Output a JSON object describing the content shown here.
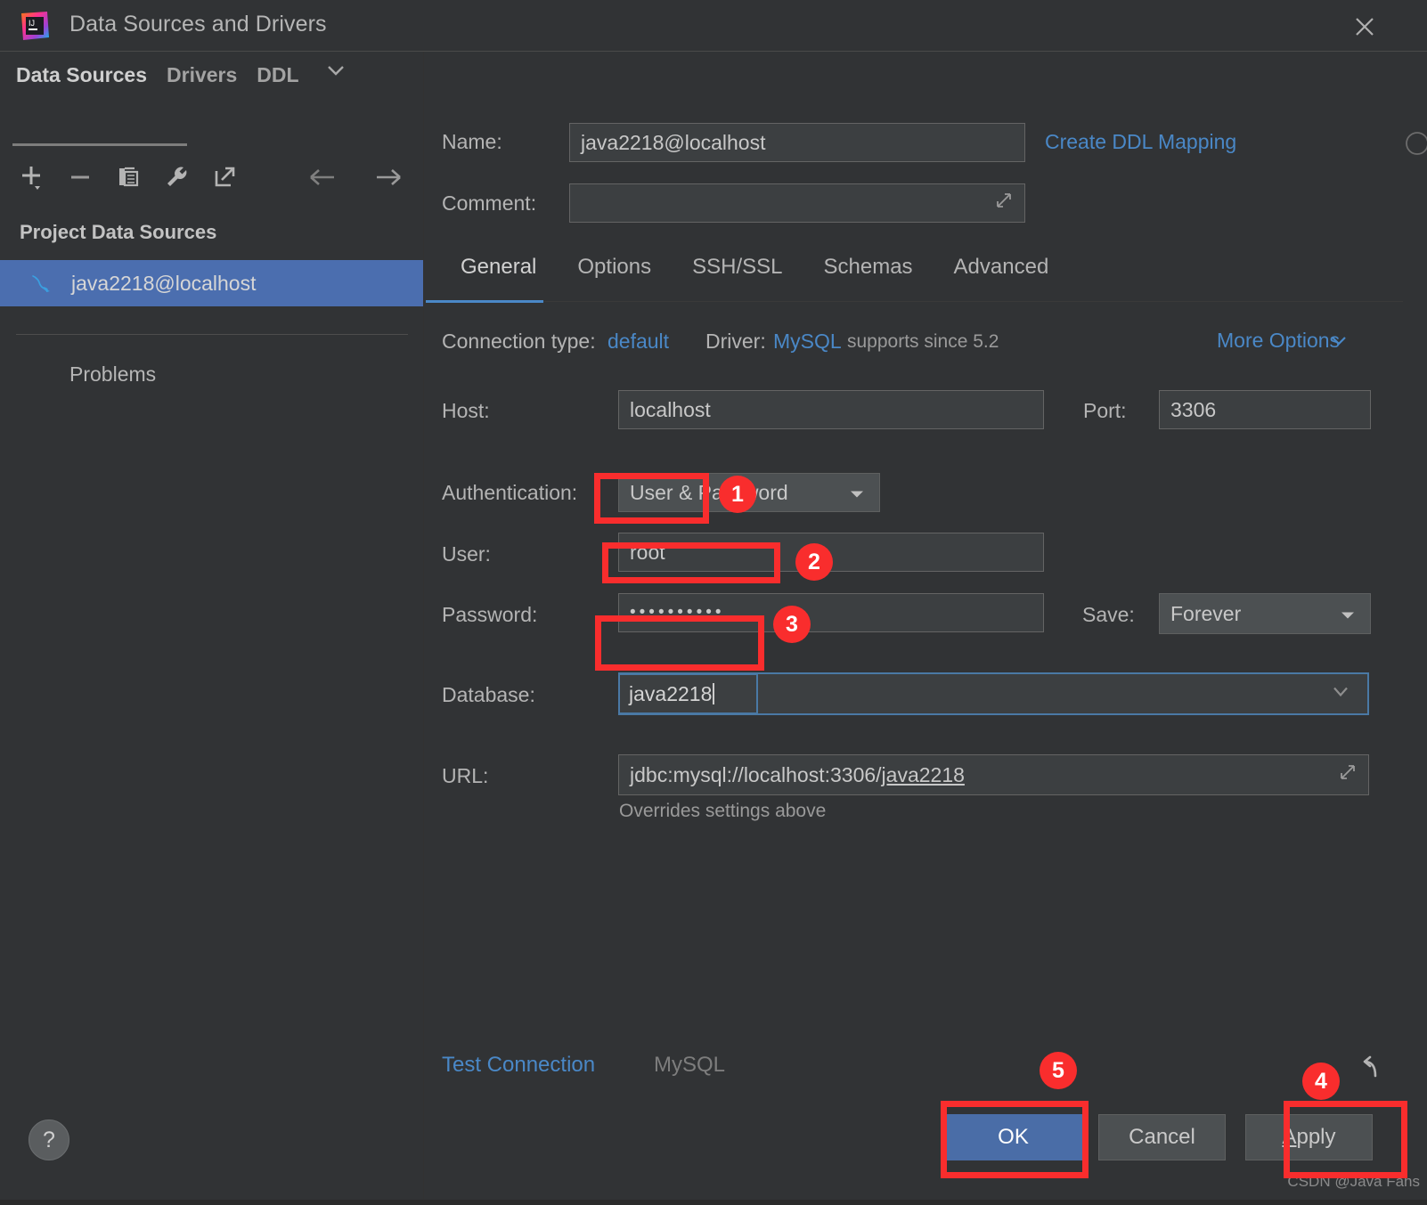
{
  "window": {
    "title": "Data Sources and Drivers",
    "app_icon": "intellij-idea-icon",
    "close_icon": "close-icon"
  },
  "sidebar": {
    "tabs": [
      {
        "label": "Data Sources",
        "active": true
      },
      {
        "label": "Drivers",
        "active": false
      },
      {
        "label": "DDL",
        "active": false
      }
    ],
    "ddl_chevron_icon": "chevron-down-icon",
    "toolbar": [
      {
        "name": "add-button",
        "icon": "plus-icon"
      },
      {
        "name": "remove-button",
        "icon": "minus-icon"
      },
      {
        "name": "copy-button",
        "icon": "copy-icon"
      },
      {
        "name": "properties-button",
        "icon": "wrench-icon"
      },
      {
        "name": "export-button",
        "icon": "external-link-icon"
      }
    ],
    "nav": [
      {
        "name": "back-button",
        "icon": "arrow-left-icon"
      },
      {
        "name": "forward-button",
        "icon": "arrow-right-icon"
      }
    ],
    "section_title": "Project Data Sources",
    "data_source": {
      "label": "java2218@localhost",
      "icon": "mysql-dolphin-icon",
      "selected": true
    },
    "problems_label": "Problems"
  },
  "header": {
    "name_label": "Name:",
    "name_value": "java2218@localhost",
    "name_status_icon": "circle-icon",
    "create_ddl_mapping": "Create DDL Mapping",
    "comment_label": "Comment:",
    "comment_value": "",
    "comment_placeholder": "",
    "comment_expand_icon": "expand-icon"
  },
  "tabs": [
    {
      "label": "General",
      "active": true
    },
    {
      "label": "Options",
      "active": false
    },
    {
      "label": "SSH/SSL",
      "active": false
    },
    {
      "label": "Schemas",
      "active": false
    },
    {
      "label": "Advanced",
      "active": false
    }
  ],
  "general": {
    "connection_type_label": "Connection type:",
    "connection_type_value": "default",
    "driver_label": "Driver:",
    "driver_value": "MySQL",
    "driver_note": "supports since 5.2",
    "more_options_label": "More Options",
    "more_options_icon": "chevron-down-icon",
    "host_label": "Host:",
    "host_value": "localhost",
    "port_label": "Port:",
    "port_value": "3306",
    "authentication_label": "Authentication:",
    "authentication_value": "User & Password",
    "authentication_caret_icon": "caret-down-icon",
    "user_label": "User:",
    "user_value": "root",
    "password_label": "Password:",
    "password_value": "••••••••••",
    "save_label": "Save:",
    "save_value": "Forever",
    "save_caret_icon": "caret-down-icon",
    "database_label": "Database:",
    "database_value": "java2218",
    "database_caret_icon": "chevron-down-icon",
    "url_label": "URL:",
    "url_value_plain": "jdbc:mysql://localhost:3306/",
    "url_value_link": "java2218",
    "url_expand_icon": "expand-icon",
    "overrides_note": "Overrides settings above"
  },
  "footer": {
    "test_connection": "Test Connection",
    "mysql_label": "MySQL",
    "ok_label": "OK",
    "cancel_label": "Cancel",
    "apply_label_prefix": "A",
    "apply_label_rest": "pply",
    "revert_icon": "revert-arrow-icon",
    "help_icon": "question-mark-icon",
    "watermark": "CSDN @Java Fans"
  },
  "annotations": [
    {
      "number": "1",
      "target": "user-field"
    },
    {
      "number": "2",
      "target": "password-field"
    },
    {
      "number": "3",
      "target": "database-field"
    },
    {
      "number": "4",
      "target": "apply-button"
    },
    {
      "number": "5",
      "target": "ok-button"
    }
  ],
  "colors": {
    "dialog_bg": "#313335",
    "selection_blue": "#4b6eaf",
    "link_blue": "#4a88c7",
    "annotation_red": "#f92d2d",
    "primary_button": "#4a6da7"
  }
}
